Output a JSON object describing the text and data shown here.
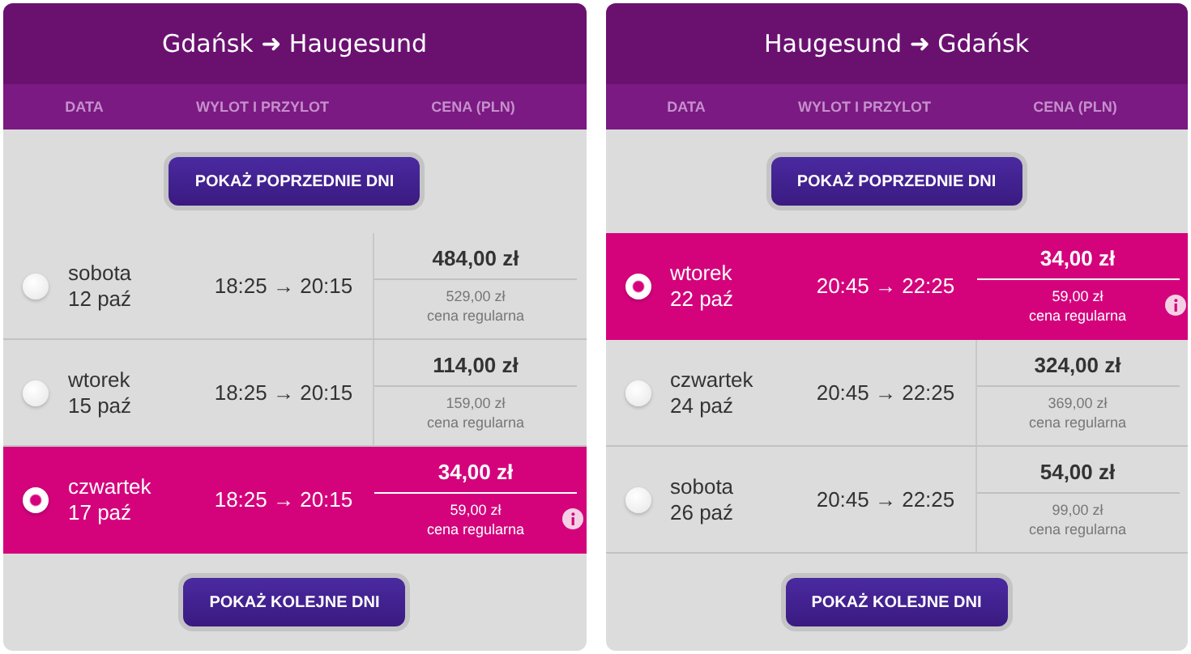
{
  "panels": [
    {
      "title": "Gdańsk ➜ Haugesund",
      "columns": [
        "DATA",
        "WYLOT I PRZYLOT",
        "CENA (PLN)"
      ],
      "prev_button": "POKAŻ POPRZEDNIE DNI",
      "next_button": "POKAŻ KOLEJNE DNI",
      "flights": [
        {
          "day": "sobota",
          "date": "12 paź",
          "times": "18:25 → 20:15",
          "price": "484,00 zł",
          "regular_price": "529,00 zł",
          "regular_label": "cena regularna",
          "selected": false
        },
        {
          "day": "wtorek",
          "date": "15 paź",
          "times": "18:25 → 20:15",
          "price": "114,00 zł",
          "regular_price": "159,00 zł",
          "regular_label": "cena regularna",
          "selected": false
        },
        {
          "day": "czwartek",
          "date": "17 paź",
          "times": "18:25 → 20:15",
          "price": "34,00 zł",
          "regular_price": "59,00 zł",
          "regular_label": "cena regularna",
          "selected": true
        }
      ]
    },
    {
      "title": "Haugesund ➜ Gdańsk",
      "columns": [
        "DATA",
        "WYLOT I PRZYLOT",
        "CENA (PLN)"
      ],
      "prev_button": "POKAŻ POPRZEDNIE DNI",
      "next_button": "POKAŻ KOLEJNE DNI",
      "flights": [
        {
          "day": "wtorek",
          "date": "22 paź",
          "times": "20:45 → 22:25",
          "price": "34,00 zł",
          "regular_price": "59,00 zł",
          "regular_label": "cena regularna",
          "selected": true
        },
        {
          "day": "czwartek",
          "date": "24 paź",
          "times": "20:45 → 22:25",
          "price": "324,00 zł",
          "regular_price": "369,00 zł",
          "regular_label": "cena regularna",
          "selected": false
        },
        {
          "day": "sobota",
          "date": "26 paź",
          "times": "20:45 → 22:25",
          "price": "54,00 zł",
          "regular_price": "99,00 zł",
          "regular_label": "cena regularna",
          "selected": false
        }
      ]
    }
  ]
}
